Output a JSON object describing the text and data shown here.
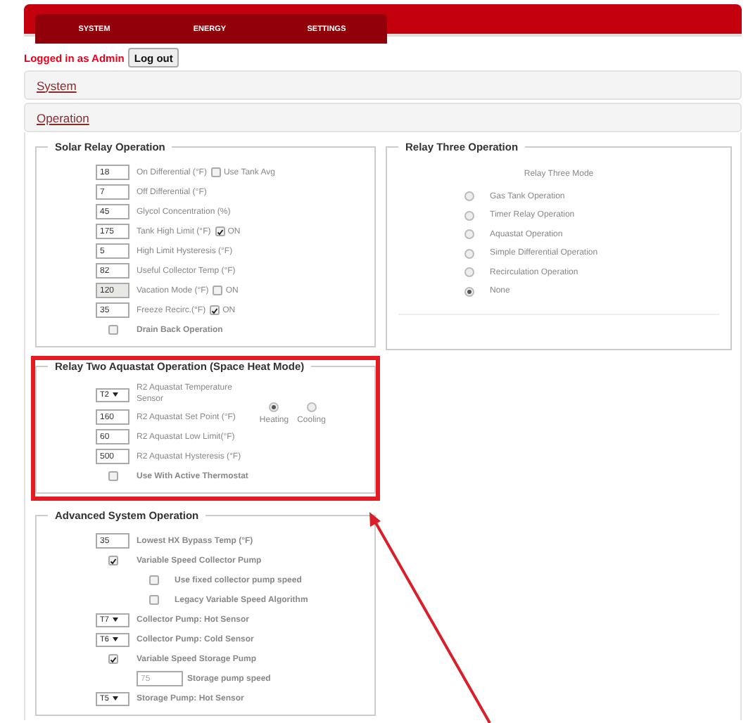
{
  "header": {
    "tabs": [
      {
        "label": "SYSTEM",
        "selected": false
      },
      {
        "label": "ENERGY",
        "selected": false
      },
      {
        "label": "SETTINGS",
        "selected": false
      }
    ]
  },
  "session": {
    "text": "Logged in as Admin",
    "button": "Log out"
  },
  "panels": [
    {
      "title": "System",
      "expanded": false
    },
    {
      "title": "Operation",
      "expanded": true
    }
  ],
  "solar_relay": {
    "legend": "Solar Relay Operation",
    "rows": [
      {
        "kind": "input",
        "value": "18",
        "label": "On Differential (°F)",
        "disabled": false,
        "option": {
          "label": "Use Tank Avg",
          "checked": false
        }
      },
      {
        "kind": "input",
        "value": "7",
        "label": "Off Differential (°F)",
        "disabled": false
      },
      {
        "kind": "input",
        "value": "45",
        "label": "Glycol Concentration (%)",
        "disabled": false
      },
      {
        "kind": "input",
        "value": "175",
        "label": "Tank High Limit (°F)",
        "disabled": false,
        "option": {
          "label": "ON",
          "checked": true
        }
      },
      {
        "kind": "input",
        "value": "5",
        "label": "High Limit Hysteresis (°F)",
        "disabled": false
      },
      {
        "kind": "input",
        "value": "82",
        "label": "Useful Collector Temp (°F)",
        "disabled": false
      },
      {
        "kind": "input",
        "value": "120",
        "label": "Vacation Mode (°F)",
        "disabled": true,
        "option": {
          "label": "ON",
          "checked": false
        }
      },
      {
        "kind": "input",
        "value": "35",
        "label": "Freeze Recirc.(°F)",
        "disabled": false,
        "option": {
          "label": "ON",
          "checked": true
        }
      },
      {
        "kind": "checkbox",
        "label": "Drain Back Operation",
        "checked": false
      }
    ]
  },
  "relay_three": {
    "legend": "Relay Three Operation",
    "mode_label": "Relay Three Mode",
    "options": [
      {
        "label": "Gas Tank Operation",
        "selected": false
      },
      {
        "label": "Timer Relay Operation",
        "selected": false
      },
      {
        "label": "Aquastat Operation",
        "selected": false
      },
      {
        "label": "Simple Differential Operation",
        "selected": false
      },
      {
        "label": "Recirculation Operation",
        "selected": false
      },
      {
        "label": "None",
        "selected": true
      }
    ]
  },
  "relay_two": {
    "legend": "Relay Two Aquastat Operation (Space Heat Mode)",
    "highlighted": true,
    "rows": [
      {
        "kind": "select",
        "value": "T2",
        "label": "R2 Aquastat Temperature Sensor"
      },
      {
        "kind": "input",
        "value": "160",
        "label": "R2 Aquastat Set Point (°F)",
        "disabled": false
      },
      {
        "kind": "input",
        "value": "60",
        "label": "R2 Aquastat Low Limit(°F)",
        "disabled": false
      },
      {
        "kind": "input",
        "value": "500",
        "label": "R2 Aquastat Hysteresis (°F)",
        "disabled": false
      },
      {
        "kind": "checkbox",
        "label": "Use With Active Thermostat",
        "checked": false
      }
    ],
    "modes": [
      {
        "label": "Heating",
        "selected": true
      },
      {
        "label": "Cooling",
        "selected": false
      }
    ]
  },
  "advanced": {
    "legend": "Advanced System Operation",
    "rows": [
      {
        "kind": "input",
        "value": "35",
        "label": "Lowest HX Bypass Temp (°F)",
        "disabled": false
      },
      {
        "kind": "checkbox",
        "label": "Variable Speed Collector Pump",
        "checked": true,
        "children": [
          {
            "kind": "checkbox",
            "label": "Use fixed collector pump speed",
            "checked": false
          },
          {
            "kind": "checkbox",
            "label": "Legacy Variable Speed Algorithm",
            "checked": false
          }
        ]
      },
      {
        "kind": "select",
        "value": "T7",
        "label": "Collector Pump: Hot Sensor"
      },
      {
        "kind": "select",
        "value": "T6",
        "label": "Collector Pump: Cold Sensor"
      },
      {
        "kind": "checkbox",
        "label": "Variable Speed Storage Pump",
        "checked": true,
        "children": [
          {
            "kind": "input",
            "placeholder": "75",
            "label": "Storage pump speed",
            "disabled": false
          }
        ]
      },
      {
        "kind": "select",
        "value": "T5",
        "label": "Storage Pump: Hot Sensor"
      }
    ]
  }
}
